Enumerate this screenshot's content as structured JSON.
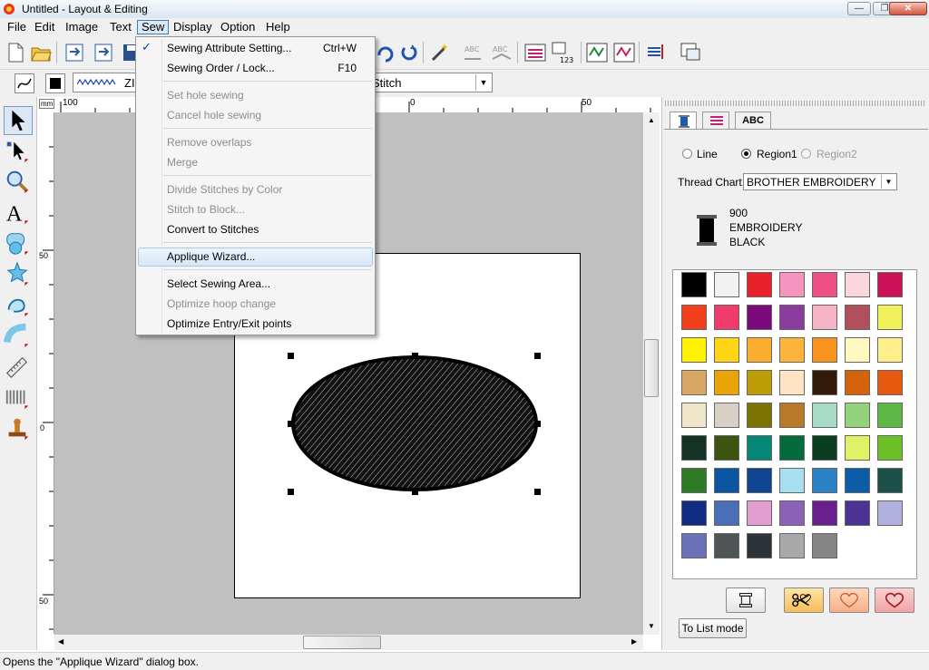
{
  "window": {
    "title": "Untitled - Layout & Editing"
  },
  "menubar": {
    "items": [
      "File",
      "Edit",
      "Image",
      "Text",
      "Sew",
      "Display",
      "Option",
      "Help"
    ],
    "active": "Sew"
  },
  "toolbar2": {
    "stitch_type": "ZI",
    "sew_type_value": "Stitch"
  },
  "sew_menu": {
    "items": [
      {
        "label": "Sewing Attribute Setting...",
        "shortcut": "Ctrl+W",
        "checked": true,
        "enabled": true
      },
      {
        "label": "Sewing Order / Lock...",
        "shortcut": "F10",
        "enabled": true
      },
      {
        "label": "Set hole sewing",
        "enabled": false
      },
      {
        "label": "Cancel hole sewing",
        "enabled": false
      },
      {
        "label": "Remove overlaps",
        "enabled": false
      },
      {
        "label": "Merge",
        "enabled": false
      },
      {
        "label": "Divide Stitches by Color",
        "enabled": false
      },
      {
        "label": "Stitch to Block...",
        "enabled": false
      },
      {
        "label": "Convert to Stitches",
        "enabled": true
      },
      {
        "label": "Applique Wizard...",
        "enabled": true,
        "highlighted": true
      },
      {
        "label": "Select Sewing Area...",
        "enabled": true
      },
      {
        "label": "Optimize hoop change",
        "enabled": false
      },
      {
        "label": "Optimize Entry/Exit points",
        "enabled": true
      }
    ]
  },
  "rulers": {
    "unit": "mm",
    "top_labels": [
      "100",
      "0",
      "50"
    ],
    "left_labels": [
      "50",
      "0",
      "50"
    ]
  },
  "panel": {
    "tab_text": "ABC",
    "radio_line": "Line",
    "radio_region1": "Region1",
    "radio_region2": "Region2",
    "thread_chart_label": "Thread Chart:",
    "thread_chart_value": "BROTHER EMBROIDERY",
    "thread_code": "900",
    "thread_name1": "EMBROIDERY",
    "thread_name2": "BLACK",
    "list_mode_button": "To List mode"
  },
  "palette_colors": [
    "#000000",
    "#f2f2f2",
    "#e8202a",
    "#f494bf",
    "#ef5086",
    "#fbd6dc",
    "#cc1159",
    "#f2401c",
    "#ef3c6c",
    "#7b0a7b",
    "#8b3d9e",
    "#f6b5c6",
    "#b24f5d",
    "#f1f15c",
    "#fff200",
    "#ffd614",
    "#fbae2d",
    "#fdb43b",
    "#f7941d",
    "#fff8c0",
    "#ffef8c",
    "#d8a764",
    "#e9a40a",
    "#be9c08",
    "#ffe3c4",
    "#341a08",
    "#d4620a",
    "#e55a0e",
    "#efe5c8",
    "#d8d0c4",
    "#7b7302",
    "#b87a2a",
    "#a6dcc6",
    "#93d17a",
    "#5cb744",
    "#163224",
    "#3c5410",
    "#068677",
    "#046c3c",
    "#0b3d22",
    "#dff266",
    "#6cbf27",
    "#2f7a25",
    "#0c55a3",
    "#0f4490",
    "#a8dff0",
    "#2a82c4",
    "#0d5ca8",
    "#1b4f48",
    "#112a82",
    "#4a6fb7",
    "#e29ed0",
    "#8c62b6",
    "#6a1f8f",
    "#4a3395",
    "#b0b1dc",
    "#6a72b7",
    "#4f5457",
    "#2c3235",
    "#a9a9a9",
    "#858585"
  ],
  "status": {
    "text": "Opens the \"Applique Wizard\" dialog box."
  }
}
